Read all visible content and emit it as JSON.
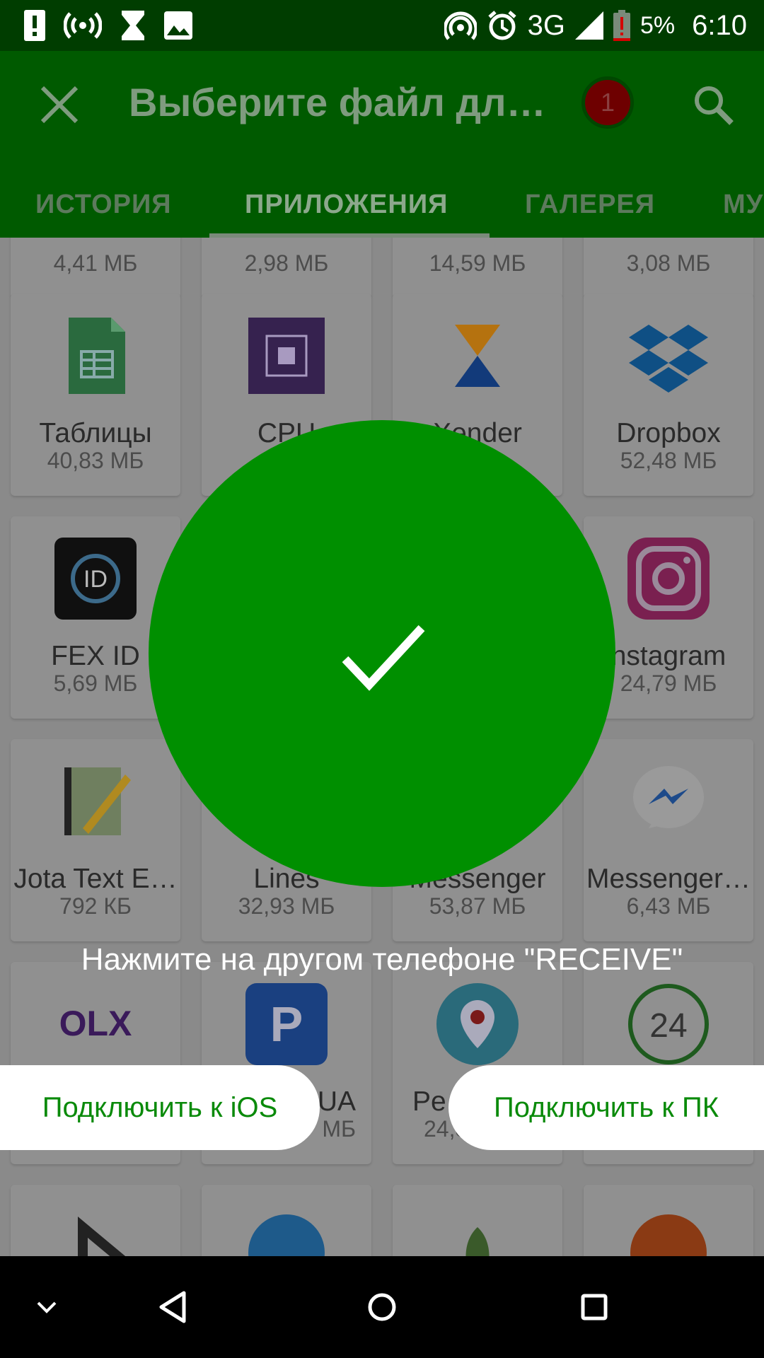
{
  "status_bar": {
    "network": "3G",
    "battery": "5%",
    "time": "6:10"
  },
  "app_bar": {
    "title": "Выберите файл дл…",
    "badge_count": "1"
  },
  "tabs": [
    {
      "label": "ИСТОРИЯ"
    },
    {
      "label": "ПРИЛОЖЕНИЯ"
    },
    {
      "label": "ГАЛЕРЕЯ"
    },
    {
      "label": "МУ"
    }
  ],
  "apps": [
    {
      "name": "",
      "size": "4,41 МБ",
      "icon": "app-icon"
    },
    {
      "name": "",
      "size": "2,98 МБ",
      "icon": "app-icon"
    },
    {
      "name": "",
      "size": "14,59 МБ",
      "icon": "app-icon"
    },
    {
      "name": "",
      "size": "3,08 МБ",
      "icon": "app-icon"
    },
    {
      "name": "Таблицы",
      "size": "40,83 МБ",
      "icon": "sheets-icon"
    },
    {
      "name": "CPU",
      "size": "",
      "icon": "cpu-icon"
    },
    {
      "name": "Xender",
      "size": "",
      "icon": "xender-icon"
    },
    {
      "name": "Dropbox",
      "size": "52,48 МБ",
      "icon": "dropbox-icon"
    },
    {
      "name": "FEX ID",
      "size": "5,69 МБ",
      "icon": "fex-id-icon"
    },
    {
      "name": "",
      "size": "",
      "icon": "app-icon"
    },
    {
      "name": "",
      "size": "",
      "icon": "app-icon"
    },
    {
      "name": "nstagram",
      "size": "24,79 МБ",
      "icon": "instagram-icon"
    },
    {
      "name": "Jota Text E…",
      "size": "792 КБ",
      "icon": "jota-icon"
    },
    {
      "name": "Lines",
      "size": "32,93 МБ",
      "icon": "lines-icon"
    },
    {
      "name": "Messenger",
      "size": "53,87 МБ",
      "icon": "messenger-icon"
    },
    {
      "name": "Messenger…",
      "size": "6,43 МБ",
      "icon": "messenger-lite-icon"
    },
    {
      "name": "",
      "size": "",
      "icon": "olx-icon"
    },
    {
      "name": "UA",
      "size": "МБ",
      "icon": "p-icon"
    },
    {
      "name": "Pe",
      "size": "24,8",
      "icon": "periscope-icon"
    },
    {
      "name": "",
      "size": "",
      "icon": "24-icon"
    },
    {
      "name": "",
      "size": "",
      "icon": "play-icon"
    },
    {
      "name": "",
      "size": "",
      "icon": "skype-icon"
    },
    {
      "name": "",
      "size": "",
      "icon": "snapseed-icon"
    },
    {
      "name": "",
      "size": "",
      "icon": "app-icon"
    }
  ],
  "overlay": {
    "message": "Нажмите на другом телефоне \"RECEIVE\"",
    "ios_button": "Подключить к iOS",
    "pc_button": "Подключить к ПК"
  },
  "colors": {
    "accent": "#008f00",
    "status_bar": "#003d00",
    "app_bar": "#005a00"
  }
}
